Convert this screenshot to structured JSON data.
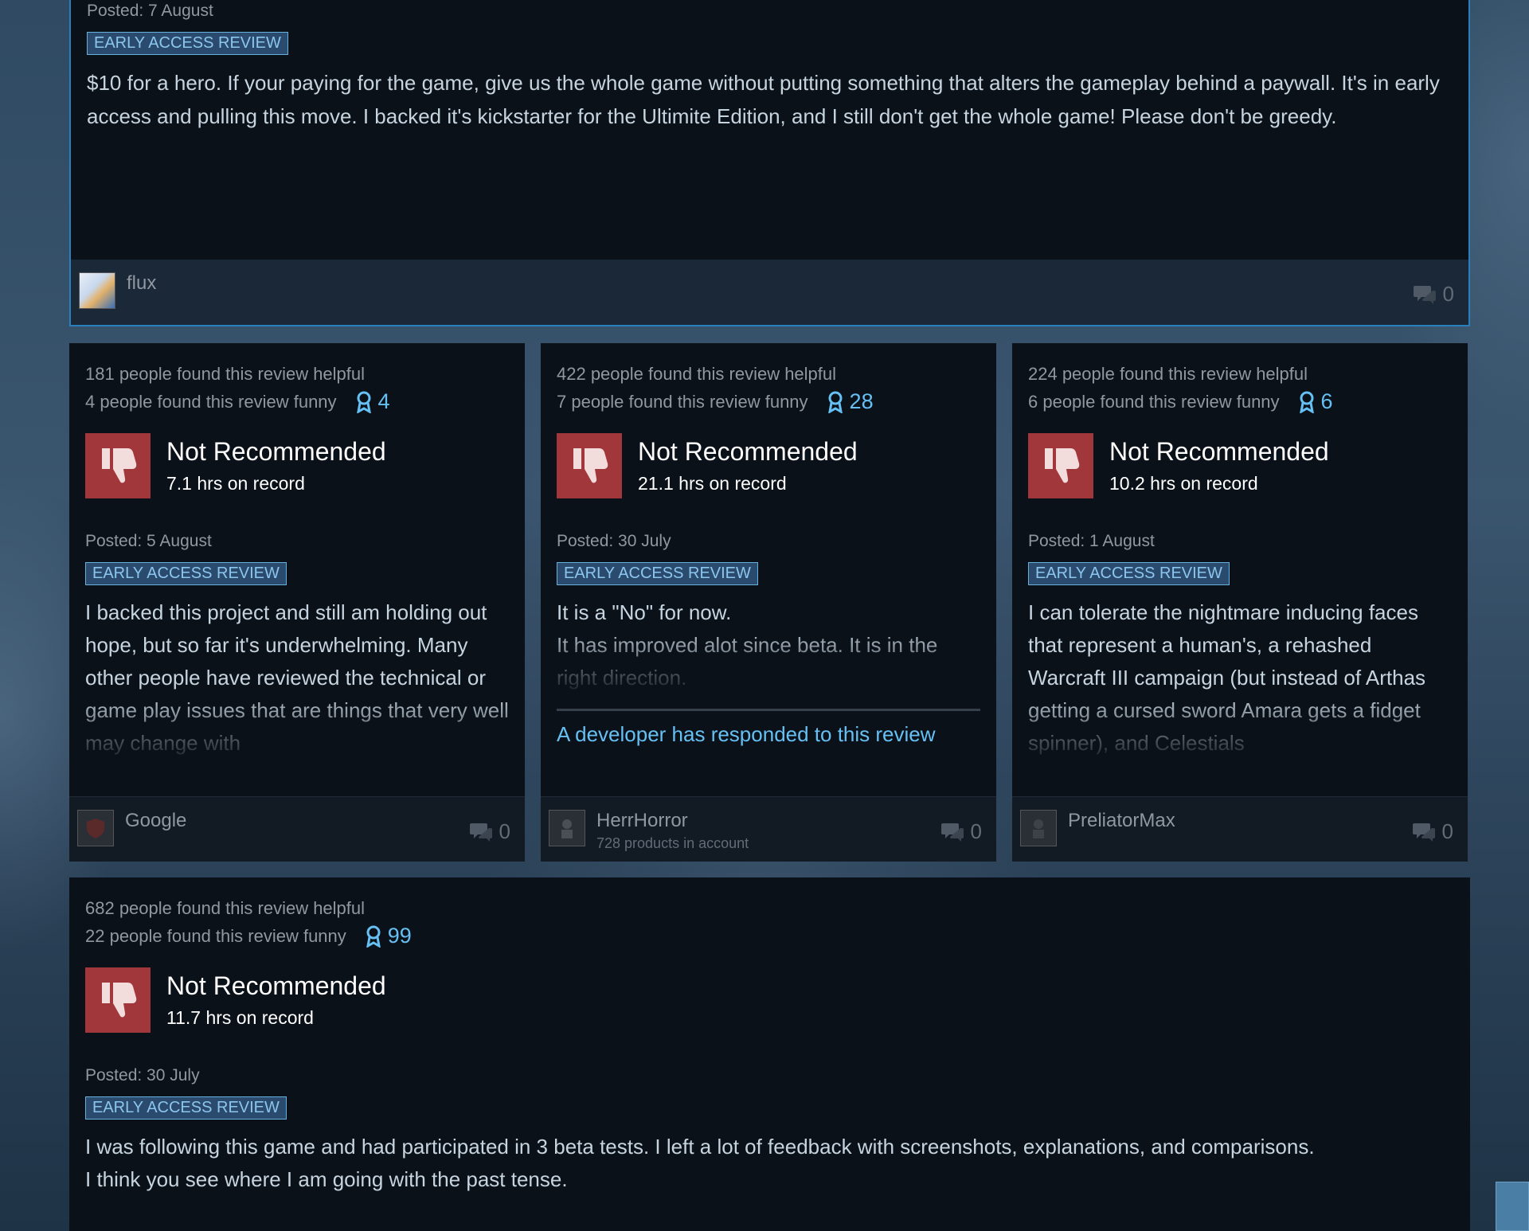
{
  "top_review": {
    "posted": "Posted: 7 August",
    "badge": "EARLY ACCESS REVIEW",
    "text": "$10 for a hero. If your paying for the game, give us the whole game without putting something that alters the gameplay behind a paywall. It's in early access and pulling this move. I backed it's kickstarter for the Ultimite Edition, and I still don't get the whole game! Please don't be greedy.",
    "username": "flux",
    "comments": "0"
  },
  "reviews": [
    {
      "helpful": "181 people found this review helpful",
      "funny": "4 people found this review funny",
      "awards": "4",
      "verdict": "Not Recommended",
      "hours": "7.1 hrs on record",
      "posted": "Posted: 5 August",
      "badge": "EARLY ACCESS REVIEW",
      "text": "I backed this project and still am holding out hope, but so far it's underwhelming. Many other people have reviewed the technical or game play issues that are things that very well may change with",
      "username": "Google",
      "comments": "0"
    },
    {
      "helpful": "422 people found this review helpful",
      "funny": "7 people found this review funny",
      "awards": "28",
      "verdict": "Not Recommended",
      "hours": "21.1 hrs on record",
      "posted": "Posted: 30 July",
      "badge": "EARLY ACCESS REVIEW",
      "text_line1": "It is a \"No\" for now.",
      "text_line2": "It has improved alot since beta. It is in the right direction.",
      "dev_response": "A developer has responded to this review",
      "username": "HerrHorror",
      "products": "728 products in account",
      "comments": "0"
    },
    {
      "helpful": "224 people found this review helpful",
      "funny": "6 people found this review funny",
      "awards": "6",
      "verdict": "Not Recommended",
      "hours": "10.2 hrs on record",
      "posted": "Posted: 1 August",
      "badge": "EARLY ACCESS REVIEW",
      "text": "I can tolerate the nightmare inducing faces that represent a human's, a rehashed Warcraft III campaign (but instead of Arthas getting a cursed sword Amara gets a fidget spinner), and Celestials",
      "username": "PreliatorMax",
      "comments": "0"
    }
  ],
  "bottom_review": {
    "helpful": "682 people found this review helpful",
    "funny": "22 people found this review funny",
    "awards": "99",
    "verdict": "Not Recommended",
    "hours": "11.7 hrs on record",
    "posted": "Posted: 30 July",
    "badge": "EARLY ACCESS REVIEW",
    "text_line1": "I was following this game and had participated in 3 beta tests. I left a lot of feedback with screenshots, explanations, and comparisons.",
    "text_line2": "I think you see where I am going with the past tense."
  },
  "colors": {
    "accent": "#66c0f4",
    "thumb_down": "#a1363b",
    "card_bg": "#0b1119",
    "highlight_border": "#2a7fbd"
  },
  "icons": [
    "thumbs-down-icon",
    "award-icon",
    "comment-icon",
    "avatar"
  ]
}
